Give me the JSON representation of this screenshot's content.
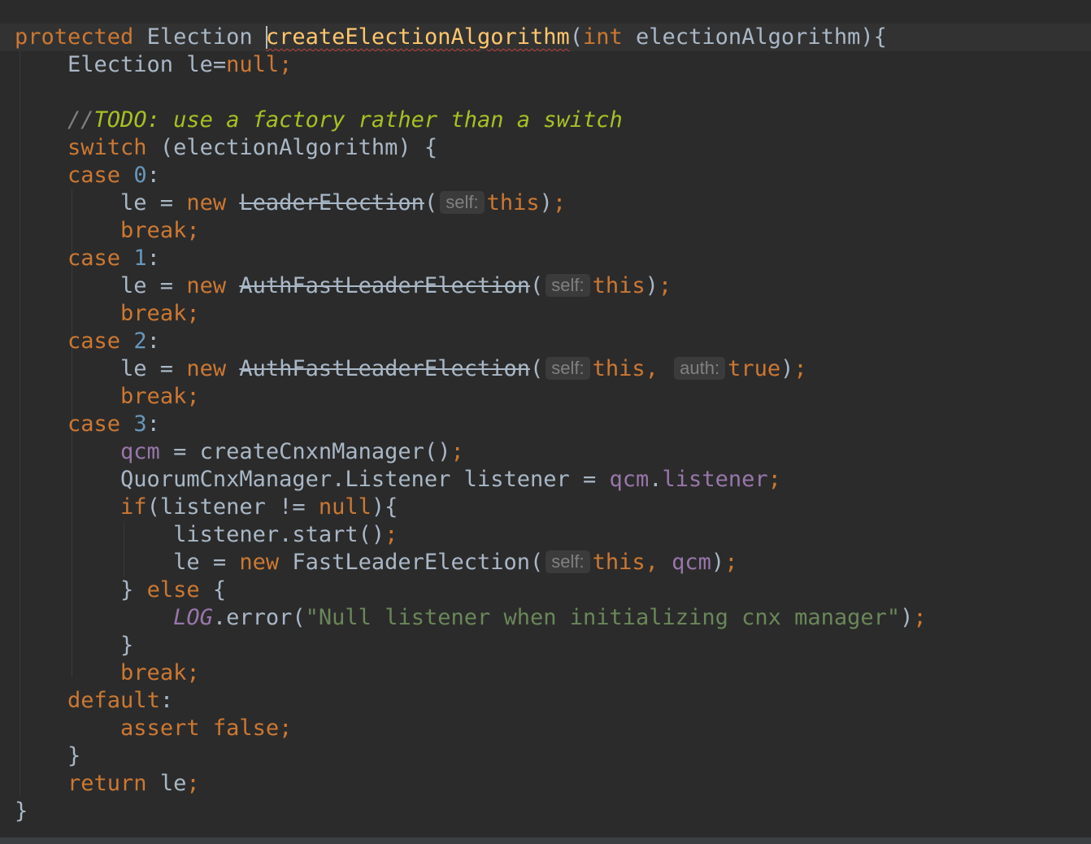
{
  "editor": {
    "lines": [
      [
        {
          "t": "protected ",
          "c": "kw"
        },
        {
          "t": "Election "
        },
        {
          "caret": true
        },
        {
          "t": "createElectionAlgorithm",
          "c": "fn squiggle"
        },
        {
          "t": "("
        },
        {
          "t": "int ",
          "c": "kw"
        },
        {
          "t": "electionAlgorithm){"
        }
      ],
      [
        {
          "t": "    Election le="
        },
        {
          "t": "null",
          "c": "kw"
        },
        {
          "t": ";",
          "c": "kw"
        }
      ],
      [],
      [
        {
          "t": "    //",
          "c": "cmt"
        },
        {
          "t": "TODO: use a factory rather than a switch",
          "c": "todo"
        }
      ],
      [
        {
          "t": "    "
        },
        {
          "t": "switch ",
          "c": "kw"
        },
        {
          "t": "(electionAlgorithm) {"
        }
      ],
      [
        {
          "t": "    "
        },
        {
          "t": "case ",
          "c": "kw"
        },
        {
          "t": "0",
          "c": "num"
        },
        {
          "t": ":"
        }
      ],
      [
        {
          "t": "        le = "
        },
        {
          "t": "new ",
          "c": "kw"
        },
        {
          "t": "LeaderElection",
          "c": "strike"
        },
        {
          "t": "("
        },
        {
          "hint": "self:"
        },
        {
          "t": "this",
          "c": "kw"
        },
        {
          "t": ")"
        },
        {
          "t": ";",
          "c": "kw"
        }
      ],
      [
        {
          "t": "        "
        },
        {
          "t": "break;",
          "c": "kw"
        }
      ],
      [
        {
          "t": "    "
        },
        {
          "t": "case ",
          "c": "kw"
        },
        {
          "t": "1",
          "c": "num"
        },
        {
          "t": ":"
        }
      ],
      [
        {
          "t": "        le = "
        },
        {
          "t": "new ",
          "c": "kw"
        },
        {
          "t": "AuthFastLeaderElection",
          "c": "strike"
        },
        {
          "t": "("
        },
        {
          "hint": "self:"
        },
        {
          "t": "this",
          "c": "kw"
        },
        {
          "t": ")"
        },
        {
          "t": ";",
          "c": "kw"
        }
      ],
      [
        {
          "t": "        "
        },
        {
          "t": "break;",
          "c": "kw"
        }
      ],
      [
        {
          "t": "    "
        },
        {
          "t": "case ",
          "c": "kw"
        },
        {
          "t": "2",
          "c": "num"
        },
        {
          "t": ":"
        }
      ],
      [
        {
          "t": "        le = "
        },
        {
          "t": "new ",
          "c": "kw"
        },
        {
          "t": "AuthFastLeaderElection",
          "c": "strike"
        },
        {
          "t": "("
        },
        {
          "hint": "self:"
        },
        {
          "t": "this, ",
          "c": "kw"
        },
        {
          "hint": "auth:"
        },
        {
          "t": "true",
          "c": "kw"
        },
        {
          "t": ")"
        },
        {
          "t": ";",
          "c": "kw"
        }
      ],
      [
        {
          "t": "        "
        },
        {
          "t": "break;",
          "c": "kw"
        }
      ],
      [
        {
          "t": "    "
        },
        {
          "t": "case ",
          "c": "kw"
        },
        {
          "t": "3",
          "c": "num"
        },
        {
          "t": ":"
        }
      ],
      [
        {
          "t": "        "
        },
        {
          "t": "qcm",
          "c": "fld"
        },
        {
          "t": " = createCnxnManager()"
        },
        {
          "t": ";",
          "c": "kw"
        }
      ],
      [
        {
          "t": "        QuorumCnxManager.Listener listener = "
        },
        {
          "t": "qcm",
          "c": "fld"
        },
        {
          "t": "."
        },
        {
          "t": "listener",
          "c": "fld"
        },
        {
          "t": ";",
          "c": "kw"
        }
      ],
      [
        {
          "t": "        "
        },
        {
          "t": "if",
          "c": "kw"
        },
        {
          "t": "(listener != "
        },
        {
          "t": "null",
          "c": "kw"
        },
        {
          "t": "){"
        }
      ],
      [
        {
          "t": "            listener.start()"
        },
        {
          "t": ";",
          "c": "kw"
        }
      ],
      [
        {
          "t": "            le = "
        },
        {
          "t": "new ",
          "c": "kw"
        },
        {
          "t": "FastLeaderElection("
        },
        {
          "hint": "self:"
        },
        {
          "t": "this, ",
          "c": "kw"
        },
        {
          "t": "qcm",
          "c": "fld"
        },
        {
          "t": ")"
        },
        {
          "t": ";",
          "c": "kw"
        }
      ],
      [
        {
          "t": "        } "
        },
        {
          "t": "else ",
          "c": "kw"
        },
        {
          "t": "{"
        }
      ],
      [
        {
          "t": "            "
        },
        {
          "t": "LOG",
          "c": "static-fld"
        },
        {
          "t": ".error("
        },
        {
          "t": "\"Null listener when initializing cnx manager\"",
          "c": "str"
        },
        {
          "t": ")"
        },
        {
          "t": ";",
          "c": "kw"
        }
      ],
      [
        {
          "t": "        }"
        }
      ],
      [
        {
          "t": "        "
        },
        {
          "t": "break;",
          "c": "kw"
        }
      ],
      [
        {
          "t": "    "
        },
        {
          "t": "default",
          "c": "kw"
        },
        {
          "t": ":"
        }
      ],
      [
        {
          "t": "        "
        },
        {
          "t": "assert false;",
          "c": "kw"
        }
      ],
      [
        {
          "t": "    }"
        }
      ],
      [
        {
          "t": "    "
        },
        {
          "t": "return ",
          "c": "kw"
        },
        {
          "t": "le"
        },
        {
          "t": ";",
          "c": "kw"
        }
      ],
      [
        {
          "t": "}"
        }
      ]
    ]
  },
  "colors": {
    "background": "#2b2b2b",
    "keyword": "#cc7832",
    "method": "#ffc66d",
    "number": "#6897bb",
    "field": "#9876aa",
    "string": "#6a8759",
    "todo": "#a8c023",
    "text": "#a9b7c6"
  }
}
